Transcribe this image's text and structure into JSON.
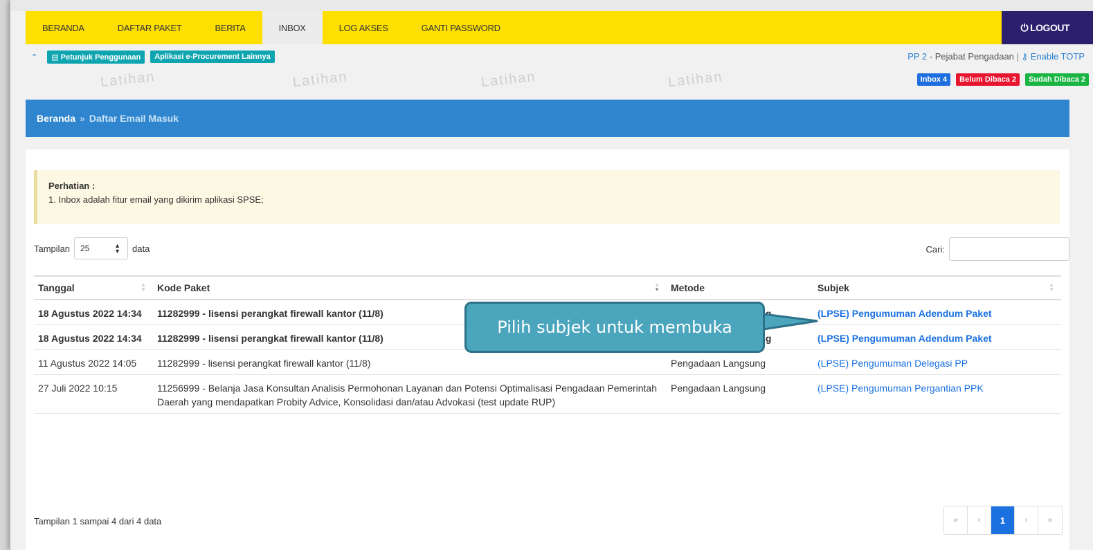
{
  "nav": {
    "items": [
      "BERANDA",
      "DAFTAR PAKET",
      "BERITA",
      "INBOX",
      "LOG AKSES",
      "GANTI PASSWORD"
    ],
    "active": "INBOX",
    "logout": "LOGOUT"
  },
  "subbar": {
    "petunjuk": "Petunjuk Penggunaan",
    "aplikasi": "Aplikasi e-Procurement Lainnya",
    "user": "PP 2",
    "role": " - Pejabat Pengadaan ",
    "separator": "|",
    "totp": "Enable TOTP"
  },
  "watermark": "Latihan",
  "badges": {
    "inbox": "Inbox 4",
    "unread": "Belum Dibaca 2",
    "read": "Sudah Dibaca 2"
  },
  "breadcrumb": {
    "home": "Beranda",
    "sep": "»",
    "current": "Daftar Email Masuk"
  },
  "alert": {
    "title": "Perhatian :",
    "text": "1. Inbox adalah fitur email yang dikirim aplikasi SPSE;"
  },
  "length": {
    "prefix": "Tampilan",
    "value": "25",
    "suffix": "data"
  },
  "search": {
    "label": "Cari:"
  },
  "table": {
    "headers": [
      "Tanggal",
      "Kode Paket",
      "Metode",
      "Subjek"
    ],
    "rows": [
      {
        "unread": true,
        "tanggal": "18 Agustus 2022 14:34",
        "kode": "11282999 - lisensi perangkat firewall kantor (11/8)",
        "metode": "Pengadaan Langsung",
        "subjek": "(LPSE) Pengumuman Adendum Paket"
      },
      {
        "unread": true,
        "tanggal": "18 Agustus 2022 14:34",
        "kode": "11282999 - lisensi perangkat firewall kantor (11/8)",
        "metode": "Pengadaan Langsung",
        "subjek": "(LPSE) Pengumuman Adendum Paket"
      },
      {
        "unread": false,
        "tanggal": "11 Agustus 2022 14:05",
        "kode": "11282999 - lisensi perangkat firewall kantor (11/8)",
        "metode": "Pengadaan Langsung",
        "subjek": "(LPSE) Pengumuman Delegasi PP"
      },
      {
        "unread": false,
        "tanggal": "27 Juli 2022 10:15",
        "kode": "11256999 - Belanja Jasa Konsultan Analisis Permohonan Layanan dan Potensi Optimalisasi Pengadaan Pemerintah Daerah yang mendapatkan Probity Advice, Konsolidasi dan/atau Advokasi (test update RUP)",
        "metode": "Pengadaan Langsung",
        "subjek": "(LPSE) Pengumuman Pergantian PPK"
      }
    ]
  },
  "info": "Tampilan 1 sampai 4 dari 4 data",
  "pager": {
    "first": "«",
    "prev": "‹",
    "current": "1",
    "next": "›",
    "last": "»"
  },
  "callout": "Pilih subjek untuk membuka",
  "colors": {
    "navbar": "#fde000",
    "logout": "#2b1f6e",
    "breadcrumb": "#2f86cf",
    "link": "#1b71e0",
    "callout": "#4aa5bd"
  }
}
